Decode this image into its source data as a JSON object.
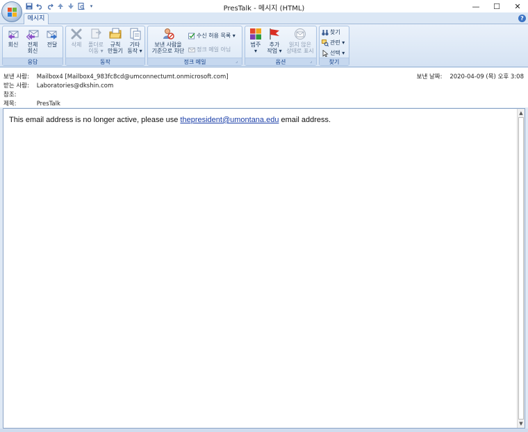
{
  "window": {
    "title": "PresTalk - 메시지 (HTML)",
    "minimize": "—",
    "maximize": "☐",
    "close": "✕"
  },
  "qat": {
    "icons": [
      "save-icon",
      "undo-icon",
      "redo-icon",
      "up-icon",
      "down-icon",
      "preview-icon",
      "customize-icon"
    ]
  },
  "ribbon": {
    "tab": "메시지",
    "help": "?",
    "groups": {
      "respond": {
        "label": "응답",
        "reply": "회신",
        "reply_all_1": "전체",
        "reply_all_2": "회신",
        "forward": "전달"
      },
      "actions": {
        "label": "동작",
        "delete": "삭제",
        "move_1": "폴더로",
        "move_2": "이동 ▾",
        "rules_1": "규칙",
        "rules_2": "만들기",
        "other_1": "기타",
        "other_2": "동작 ▾"
      },
      "junk": {
        "label": "정크 메일",
        "block_1": "보낸 사람을",
        "block_2": "기준으로 차단",
        "safe_list": "수신 허용 목록 ▾",
        "not_junk": "정크 메일 아님"
      },
      "options": {
        "label": "옵션",
        "categorize_1": "범주",
        "categorize_2": "▾",
        "followup_1": "추가",
        "followup_2": "작업 ▾",
        "unread_1": "읽지 않은",
        "unread_2": "상태로 표시"
      },
      "find": {
        "label": "찾기",
        "find": "찾기",
        "related": "관련 ▾",
        "select": "선택 ▾"
      }
    }
  },
  "header": {
    "from_label": "보낸 사람:",
    "from_value": "Mailbox4 [Mailbox4_983fc8cd@umconnectumt.onmicrosoft.com]",
    "to_label": "받는 사람:",
    "to_value": "Laboratories@dkshin.com",
    "cc_label": "참조:",
    "cc_value": "",
    "subject_label": "제목:",
    "subject_value": "PresTalk",
    "sent_label": "보낸 날짜:",
    "sent_value": "2020-04-09 (목) 오후 3:08"
  },
  "body": {
    "text_before": "This email address is no longer active, please use ",
    "link": "thepresident@umontana.edu",
    "text_after": " email address."
  }
}
